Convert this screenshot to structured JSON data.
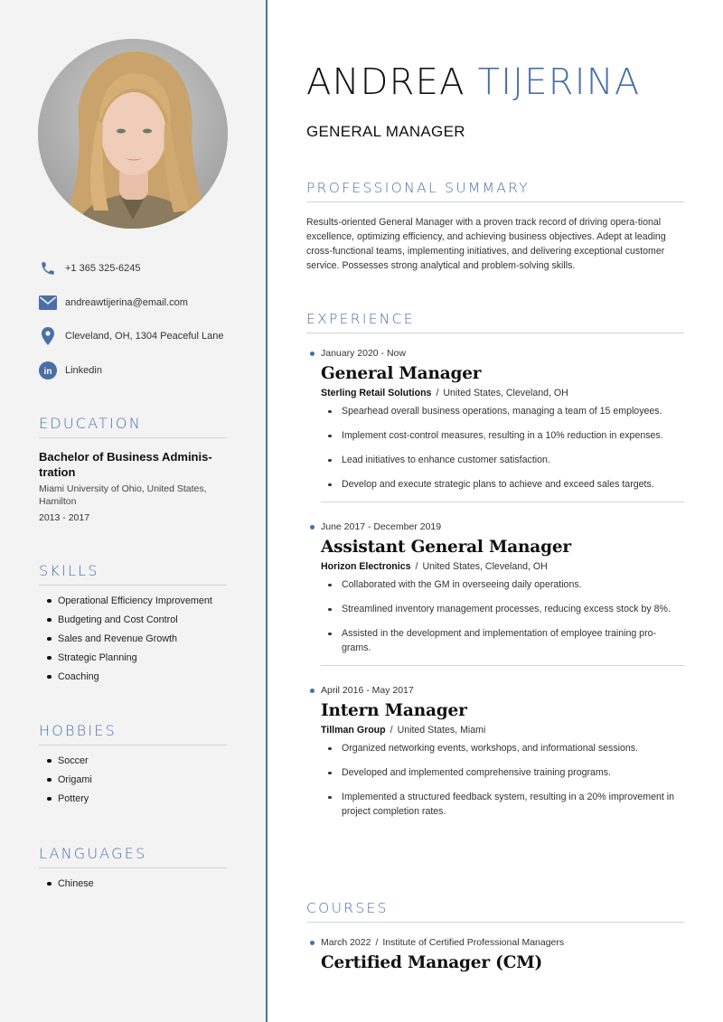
{
  "header": {
    "first_name": "ANDREA",
    "last_name": "TIJERINA",
    "job_title": "GENERAL MANAGER"
  },
  "colors": {
    "accent": "#4a6fa8",
    "sidebar_bg": "#f3f3f3",
    "divider": "#cfd3d8"
  },
  "sidebar": {
    "photo_alt": "Profile photo of a woman with long blonde hair",
    "contact": [
      {
        "icon": "phone-icon",
        "text": "+1 365 325-6245"
      },
      {
        "icon": "email-icon",
        "text": "andreawtijerina@email.com"
      },
      {
        "icon": "location-pin-icon",
        "text": "Cleveland, OH, 1304 Peaceful Lane"
      },
      {
        "icon": "linkedin-icon",
        "text": "Linkedin"
      }
    ],
    "education": {
      "heading": "EDUCATION",
      "degree": "Bachelor of Business Adminis-tration",
      "school": "Miami University of Ohio, United States, Hamilton",
      "years": "2013 - 2017"
    },
    "skills": {
      "heading": "SKILLS",
      "items": [
        "Operational Efficiency Improvement",
        "Budgeting and Cost Control",
        "Sales and Revenue Growth",
        "Strategic Planning",
        "Coaching"
      ]
    },
    "hobbies": {
      "heading": "HOBBIES",
      "items": [
        "Soccer",
        "Origami",
        "Pottery"
      ]
    },
    "languages": {
      "heading": "LANGUAGES",
      "items": [
        "Chinese"
      ]
    }
  },
  "summary": {
    "heading": "PROFESSIONAL SUMMARY",
    "text": "Results-oriented General Manager with a proven track record of driving opera-tional excellence, optimizing efficiency, and achieving business objectives. Adept at leading cross-functional teams, implementing initiatives, and delivering exceptional customer service. Possesses strong analytical and problem-solving skills."
  },
  "experience": {
    "heading": "EXPERIENCE",
    "jobs": [
      {
        "dates": "January 2020 - Now",
        "role": "General Manager",
        "company": "Sterling Retail Solutions",
        "location": "United States, Cleveland, OH",
        "bullets": [
          "Spearhead overall business operations, managing a team of 15 employees.",
          "Implement cost-control measures, resulting in a 10% reduction in expenses.",
          "Lead initiatives to enhance customer satisfaction.",
          "Develop and execute strategic plans to achieve and exceed sales targets."
        ]
      },
      {
        "dates": "June 2017 - December 2019",
        "role": "Assistant General Manager",
        "company": "Horizon Electronics",
        "location": "United States, Cleveland, OH",
        "bullets": [
          "Collaborated with the GM in overseeing daily operations.",
          "Streamlined inventory management processes, reducing excess stock by 8%.",
          "Assisted in the development and implementation of employee training pro-grams."
        ]
      },
      {
        "dates": "April 2016 - May 2017",
        "role": "Intern Manager",
        "company": "Tillman Group",
        "location": "United States, Miami",
        "bullets": [
          "Organized networking events, workshops, and informational sessions.",
          "Developed and implemented comprehensive training programs.",
          "Implemented a structured feedback system, resulting in a 20% improvement in project completion rates."
        ]
      }
    ]
  },
  "courses": {
    "heading": "COURSES",
    "items": [
      {
        "date": "March 2022",
        "institution": "Institute of Certified Professional Managers",
        "title": "Certified Manager (CM)"
      }
    ]
  },
  "separator": "/"
}
